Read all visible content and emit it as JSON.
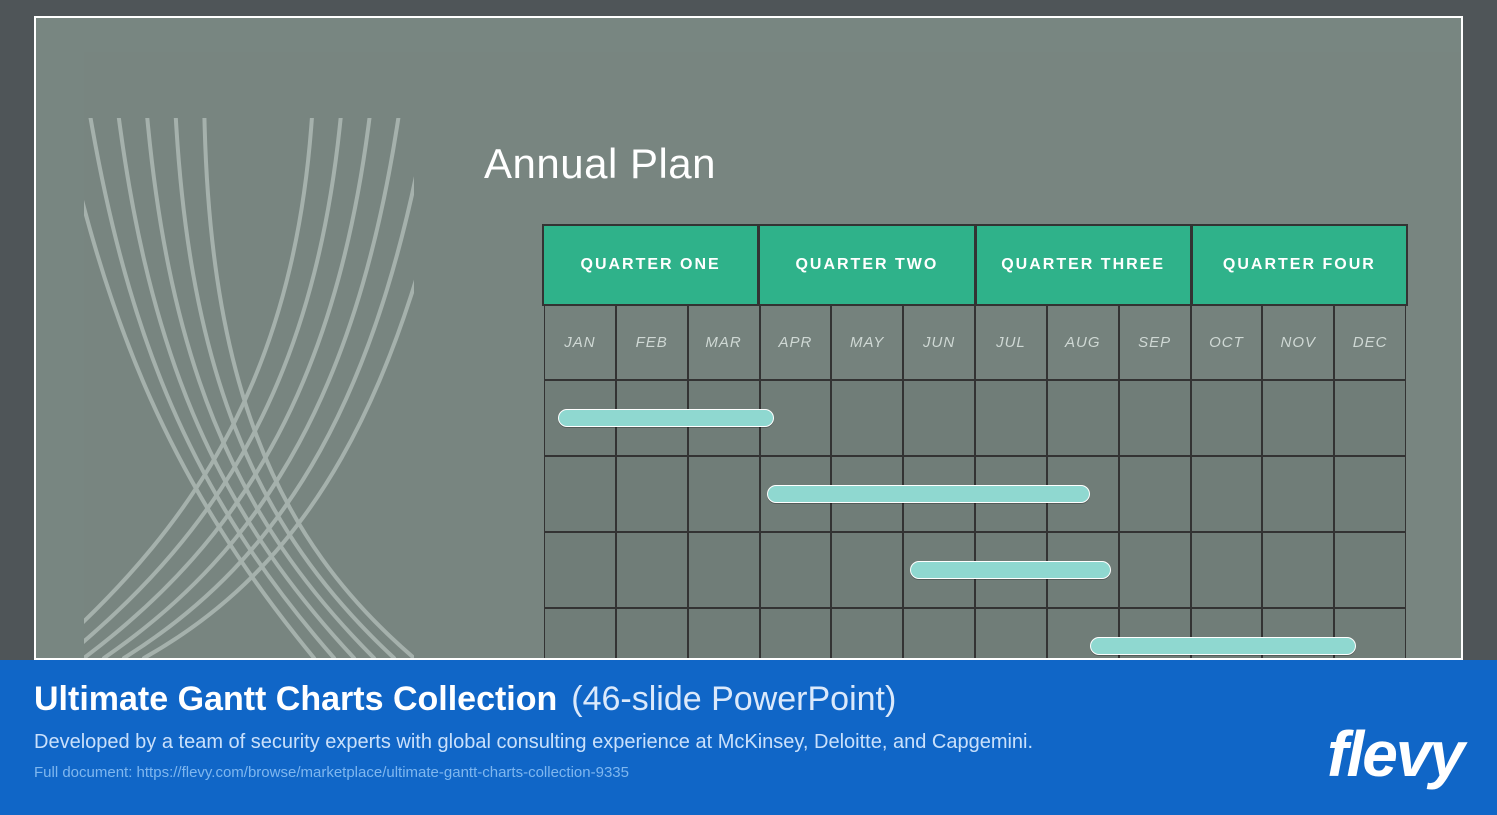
{
  "title": "Annual Plan",
  "quarters": [
    "QUARTER ONE",
    "QUARTER TWO",
    "QUARTER THREE",
    "QUARTER FOUR"
  ],
  "months": [
    "JAN",
    "FEB",
    "MAR",
    "APR",
    "MAY",
    "JUN",
    "JUL",
    "AUG",
    "SEP",
    "OCT",
    "NOV",
    "DEC"
  ],
  "colors": {
    "header_bg": "#2fb28a",
    "bar": "#8fd8d0",
    "slide_bg": "#788681",
    "page_bg": "#4f5558",
    "footer_bg": "#1066c7"
  },
  "footer": {
    "product_bold": "Ultimate Gantt Charts Collection",
    "product_paren": "(46-slide PowerPoint)",
    "subtitle": "Developed by a team of security experts with global consulting experience at McKinsey, Deloitte, and Capgemini.",
    "url_line": "Full document: https://flevy.com/browse/marketplace/ultimate-gantt-charts-collection-9335",
    "brand": "flevy"
  },
  "chart_data": {
    "type": "gantt",
    "title": "Annual Plan",
    "categories": [
      "JAN",
      "FEB",
      "MAR",
      "APR",
      "MAY",
      "JUN",
      "JUL",
      "AUG",
      "SEP",
      "OCT",
      "NOV",
      "DEC"
    ],
    "quarters": [
      {
        "name": "QUARTER ONE",
        "months": [
          "JAN",
          "FEB",
          "MAR"
        ]
      },
      {
        "name": "QUARTER TWO",
        "months": [
          "APR",
          "MAY",
          "JUN"
        ]
      },
      {
        "name": "QUARTER THREE",
        "months": [
          "JUL",
          "AUG",
          "SEP"
        ]
      },
      {
        "name": "QUARTER FOUR",
        "months": [
          "OCT",
          "NOV",
          "DEC"
        ]
      }
    ],
    "tasks": [
      {
        "row": 0,
        "start_month": 0.2,
        "end_month": 3.2
      },
      {
        "row": 1,
        "start_month": 3.1,
        "end_month": 7.6
      },
      {
        "row": 2,
        "start_month": 5.1,
        "end_month": 7.9
      },
      {
        "row": 3,
        "start_month": 7.6,
        "end_month": 11.3
      }
    ],
    "note": "start_month/end_month are 0-based positions across the 12-month axis; row 0's bar visually begins slightly left of the JAN column on the slide."
  }
}
